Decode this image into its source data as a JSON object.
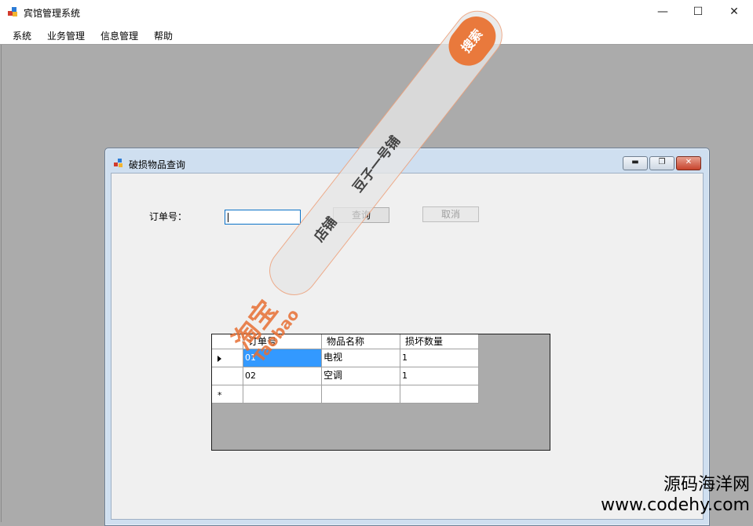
{
  "window": {
    "title": "宾馆管理系统",
    "controls": {
      "minimize": "—",
      "maximize": "☐",
      "close": "✕"
    }
  },
  "menu": [
    "系统",
    "业务管理",
    "信息管理",
    "帮助"
  ],
  "child": {
    "title": "破损物品查询",
    "controls": {
      "minimize": "▬",
      "restore": "❐",
      "close": "✕"
    },
    "order_label": "订单号：",
    "order_value": "",
    "query_button": "查询",
    "cancel_button": "取消",
    "grid": {
      "columns": [
        "订单号",
        "物品名称",
        "损坏数量"
      ],
      "rows": [
        [
          "01",
          "电视",
          "1"
        ],
        [
          "02",
          "空调",
          "1"
        ]
      ],
      "new_row_marker": "*"
    }
  },
  "overlay": {
    "shop_label": "店铺",
    "shop_name": "豆子一号铺",
    "search_button": "搜索",
    "brand_cn": "淘宝",
    "brand_en": "Taobao",
    "site_cn": "源码海洋网",
    "site_url": "www.codehy.com"
  },
  "colors": {
    "selection": "#3399ff",
    "mdi_background": "#ababab",
    "accent_orange": "#e9793c"
  }
}
